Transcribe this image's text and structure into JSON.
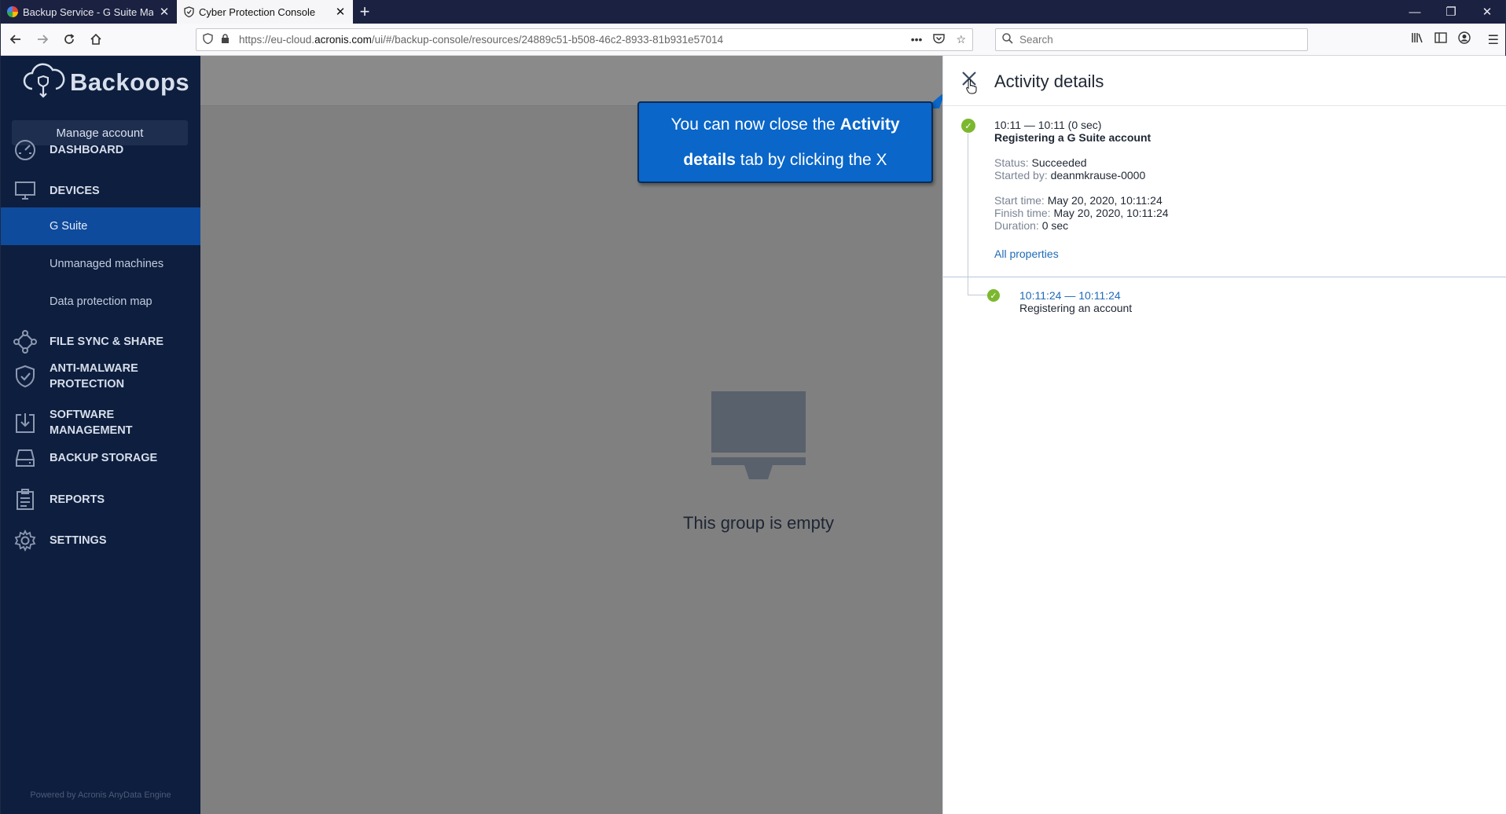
{
  "browser": {
    "tabs": [
      {
        "title": "Backup Service - G Suite Marke",
        "active": false
      },
      {
        "title": "Cyber Protection Console",
        "active": true
      }
    ],
    "url_prefix": "https://eu-cloud.",
    "url_domain": "acronis.com",
    "url_path": "/ui/#/backup-console/resources/24889c51-b508-46c2-8933-81b931e57014",
    "search_placeholder": "Search"
  },
  "sidebar": {
    "logo_text": "Backoops",
    "manage_account": "Manage account",
    "items": {
      "dashboard": "DASHBOARD",
      "devices": "DEVICES",
      "g_suite": "G Suite",
      "unmanaged": "Unmanaged machines",
      "data_protection_map": "Data protection map",
      "file_sync": "FILE SYNC & SHARE",
      "anti_malware_1": "ANTI-MALWARE",
      "anti_malware_2": "PROTECTION",
      "software_1": "SOFTWARE",
      "software_2": "MANAGEMENT",
      "backup_storage": "BACKUP STORAGE",
      "reports": "REPORTS",
      "settings": "SETTINGS"
    },
    "powered_by": "Powered by Acronis AnyData Engine"
  },
  "main": {
    "empty_text": "This group is empty"
  },
  "callout": {
    "part1": "You can now close the ",
    "bold1": "Activity",
    "bold2": "details",
    "part2": " tab by clicking the X"
  },
  "activity": {
    "title": "Activity details",
    "time_range": "10:11 — 10:11 (0 sec)",
    "name": "Registering a G Suite account",
    "status_label": "Status:",
    "status_value": "Succeeded",
    "started_by_label": "Started by:",
    "started_by_value": "deanmkrause-0000",
    "start_time_label": "Start time:",
    "start_time_value": "May 20, 2020, 10:11:24",
    "finish_time_label": "Finish time:",
    "finish_time_value": "May 20, 2020, 10:11:24",
    "duration_label": "Duration:",
    "duration_value": "0 sec",
    "all_properties": "All properties",
    "sub_time": "10:11:24 — 10:11:24",
    "sub_name": "Registering an account"
  }
}
